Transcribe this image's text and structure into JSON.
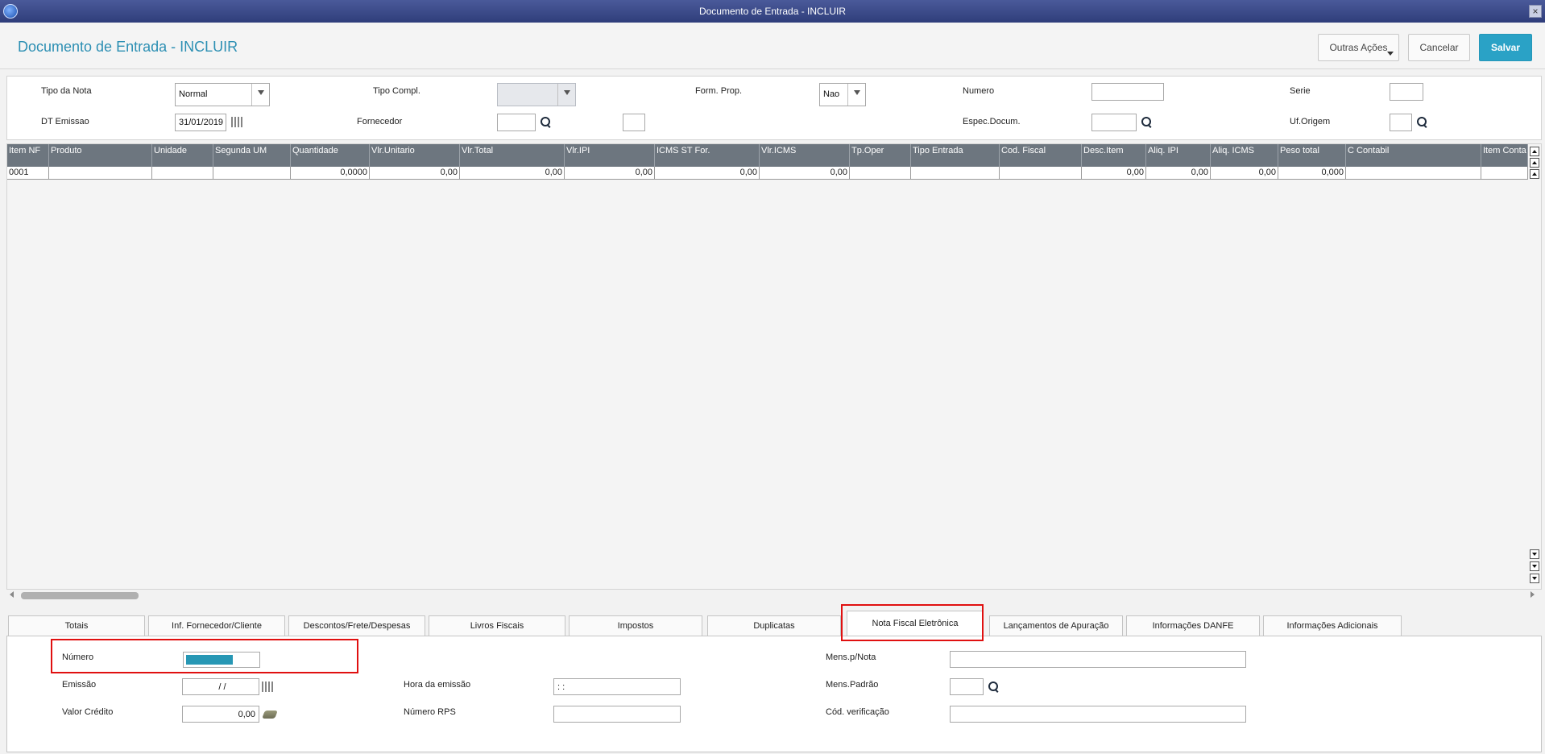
{
  "window": {
    "title": "Documento de Entrada - INCLUIR"
  },
  "header": {
    "title": "Documento de Entrada - INCLUIR",
    "outras_label": "Outras Ações",
    "cancel_label": "Cancelar",
    "save_label": "Salvar"
  },
  "form": {
    "tipo_nota_label": "Tipo da Nota",
    "tipo_nota_value": "Normal",
    "tipo_compl_label": "Tipo Compl.",
    "tipo_compl_value": "",
    "form_prop_label": "Form. Prop.",
    "form_prop_value": "Nao",
    "numero_label": "Numero",
    "numero_value": "",
    "serie_label": "Serie",
    "serie_value": "",
    "dt_emissao_label": "DT Emissao",
    "dt_emissao_value": "31/01/2019",
    "fornecedor_label": "Fornecedor",
    "fornecedor_value": "",
    "fornecedor_loja_value": "",
    "espec_label": "Espec.Docum.",
    "espec_value": "",
    "uf_label": "Uf.Origem",
    "uf_value": ""
  },
  "grid": {
    "columns": [
      "Item NF",
      "Produto",
      "Unidade",
      "Segunda UM",
      "Quantidade",
      "Vlr.Unitario",
      "Vlr.Total",
      "Vlr.IPI",
      "ICMS ST For.",
      "Vlr.ICMS",
      "Tp.Oper",
      "Tipo Entrada",
      "Cod. Fiscal",
      "Desc.Item",
      "Aliq. IPI",
      "Aliq. ICMS",
      "Peso total",
      "C Contabil",
      "Item Conta"
    ],
    "rows": [
      [
        "0001",
        "",
        "",
        "",
        "0,0000",
        "0,00",
        "0,00",
        "0,00",
        "0,00",
        "0,00",
        "",
        "",
        "",
        "0,00",
        "0,00",
        "0,00",
        "0,000",
        "",
        ""
      ]
    ]
  },
  "tabs": [
    "Totais",
    "Inf. Fornecedor/Cliente",
    "Descontos/Frete/Despesas",
    "Livros Fiscais",
    "Impostos",
    "Duplicatas",
    "Nota Fiscal Eletrônica",
    "Lançamentos de Apuração",
    "Informações DANFE",
    "Informações Adicionais"
  ],
  "active_tab": "Nota Fiscal Eletrônica",
  "nfe": {
    "numero_label": "Número",
    "emissao_label": "Emissão",
    "emissao_value": " /  /",
    "valor_credito_label": "Valor Crédito",
    "valor_credito_value": "0,00",
    "hora_label": "Hora da emissão",
    "hora_value": " :  :",
    "rps_label": "Número RPS",
    "rps_value": "",
    "mens_nota_label": "Mens.p/Nota",
    "mens_nota_value": "",
    "mens_padrao_label": "Mens.Padrão",
    "mens_padrao_value": "",
    "cod_verif_label": "Cód. verificação",
    "cod_verif_value": ""
  }
}
